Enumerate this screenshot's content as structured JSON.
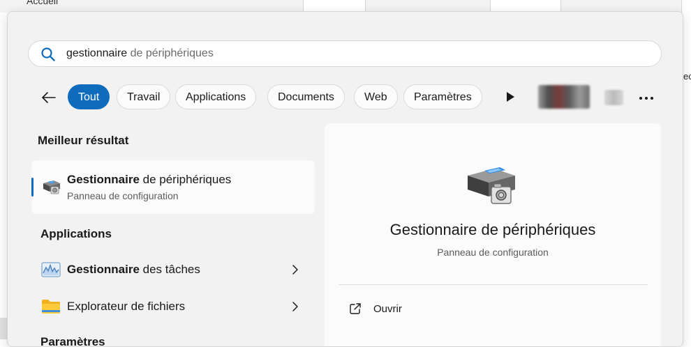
{
  "background": {
    "top_left_text": "Accueil",
    "right_edge_text": "ec"
  },
  "search": {
    "typed": "gestionnaire",
    "suggestion": " de périphériques"
  },
  "filters": {
    "chips": [
      {
        "label": "Tout",
        "active": true
      },
      {
        "label": "Travail",
        "active": false
      },
      {
        "label": "Applications",
        "active": false
      },
      {
        "label": "Documents",
        "active": false
      },
      {
        "label": "Web",
        "active": false
      },
      {
        "label": "Paramètres",
        "active": false
      }
    ]
  },
  "results": {
    "best_heading": "Meilleur résultat",
    "best": {
      "title_bold": "Gestionnaire",
      "title_rest": " de périphériques",
      "subtitle": "Panneau de configuration",
      "icon": "device-manager-icon"
    },
    "apps_heading": "Applications",
    "apps": [
      {
        "bold": "Gestionnaire",
        "rest": " des tâches",
        "icon": "task-manager-icon"
      },
      {
        "bold": "",
        "rest": "Explorateur de fichiers",
        "icon": "folder-icon"
      }
    ],
    "next_heading": "Paramètres"
  },
  "detail": {
    "title": "Gestionnaire de périphériques",
    "subtitle": "Panneau de configuration",
    "actions": [
      {
        "label": "Ouvrir",
        "icon": "open-external-icon"
      }
    ]
  },
  "colors": {
    "accent": "#0f6cbd",
    "panel": "#f2f2f2",
    "card": "#fbfbfb"
  }
}
